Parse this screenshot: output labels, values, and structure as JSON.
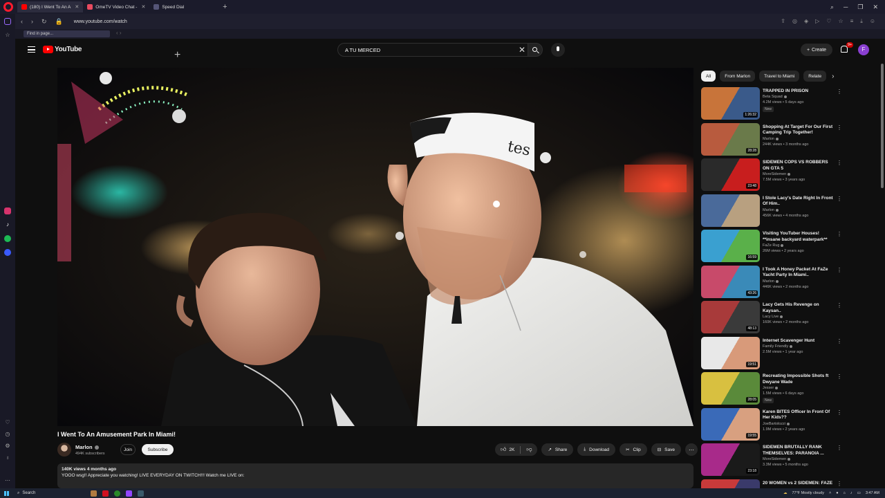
{
  "browser": {
    "tabs": [
      {
        "label": "(180) I Went To An A",
        "active": true,
        "color": "#ff0000"
      },
      {
        "label": "OmeTV Video Chat -",
        "active": false,
        "color": "#e84a5f"
      },
      {
        "label": "Speed Dial",
        "active": false,
        "color": "#8888aa"
      }
    ],
    "new_tab_label": "+",
    "url": "www.youtube.com/watch",
    "find_placeholder": "Find in page..."
  },
  "youtube": {
    "logo_text": "YouTube",
    "search_value": "A TU MERCED",
    "create_label": "Create",
    "notification_count": "9+",
    "avatar_letter": "F"
  },
  "video": {
    "title": "I Went To An Amusement Park In Miami!",
    "channel": "Marlon",
    "subscribers": "494K subscribers",
    "join_label": "Join",
    "subscribe_label": "Subscribe",
    "likes": "2K",
    "share_label": "Share",
    "download_label": "Download",
    "clip_label": "Clip",
    "save_label": "Save",
    "views_date": "140K views  4 months ago",
    "description": "YOOO wsg!! Appreciate you watching! LIVE EVERYDAY ON TWITCH!!! Watch me LIVE on:",
    "cap_text": "tes"
  },
  "chips": [
    {
      "label": "All",
      "active": true
    },
    {
      "label": "From Marlon",
      "active": false
    },
    {
      "label": "Travel to Miami",
      "active": false
    },
    {
      "label": "Relate",
      "active": false
    }
  ],
  "recommendations": [
    {
      "title": "TRAPPED IN PRISON",
      "channel": "Beta Squad",
      "meta": "4.2M views • 5 days ago",
      "badge": "New",
      "duration": "1:26:32",
      "colors": [
        "#c8743a",
        "#3a5a8a"
      ]
    },
    {
      "title": "Shopping At Target For Our First Camping Trip Together!",
      "channel": "Marlon",
      "meta": "244K views • 3 months ago",
      "badge": "",
      "duration": "28:28",
      "colors": [
        "#b85b3e",
        "#6a7a4a"
      ]
    },
    {
      "title": "SIDEMEN COPS VS ROBBERS ON GTA 5",
      "channel": "MoreSidemen",
      "meta": "7.5M views • 3 years ago",
      "badge": "",
      "duration": "23:48",
      "colors": [
        "#2a2a2a",
        "#c81e1e"
      ]
    },
    {
      "title": "I Stole Lacy's Date Right In Front Of Him..",
      "channel": "Marlon",
      "meta": "456K views • 4 months ago",
      "badge": "",
      "duration": "",
      "colors": [
        "#4a6a9a",
        "#b8a080"
      ]
    },
    {
      "title": "Visiting YouTuber Houses! **insane backyard waterpark**",
      "channel": "FaZe Rug",
      "meta": "26M views • 2 years ago",
      "badge": "",
      "duration": "16:59",
      "colors": [
        "#3aa0d0",
        "#5ab04a"
      ]
    },
    {
      "title": "I Took A Honey Packet At FaZe Yacht Party In Miami..",
      "channel": "Marlon",
      "meta": "446K views • 2 months ago",
      "badge": "",
      "duration": "43:26",
      "colors": [
        "#c84a6a",
        "#3a8ab8"
      ]
    },
    {
      "title": "Lacy Gets His Revenge on Kaysan..",
      "channel": "Lacy Live",
      "meta": "160K views • 2 months ago",
      "badge": "",
      "duration": "48:13",
      "colors": [
        "#a83a3a",
        "#3a3a3a"
      ]
    },
    {
      "title": "Internet Scavenger Hunt",
      "channel": "Family Friendly",
      "meta": "2.5M views • 1 year ago",
      "badge": "",
      "duration": "19:51",
      "colors": [
        "#e8e8e8",
        "#d89a7a"
      ]
    },
    {
      "title": "Recreating Impossible Shots ft Dwyane Wade",
      "channel": "Jesser",
      "meta": "1.5M views • 6 days ago",
      "badge": "New",
      "duration": "28:05",
      "colors": [
        "#d8c040",
        "#5a8a3a"
      ]
    },
    {
      "title": "Karen BITES Officer In Front Of Her Kids??",
      "channel": "JoeBartolozzi",
      "meta": "1.9M views • 2 years ago",
      "badge": "",
      "duration": "19:55",
      "colors": [
        "#3a6ab8",
        "#d8a080"
      ]
    },
    {
      "title": "SIDEMEN BRUTALLY RANK THEMSELVES: PARANOIA ...",
      "channel": "MoreSidemen",
      "meta": "3.3M views • 5 months ago",
      "badge": "",
      "duration": "23:18",
      "colors": [
        "#a82a8a",
        "#1a1a1a"
      ]
    },
    {
      "title": "20 WOMEN vs 2 SIDEMEN: FAZE",
      "channel": "",
      "meta": "",
      "badge": "",
      "duration": "",
      "colors": [
        "#c83a3a",
        "#3a3a6a"
      ]
    }
  ],
  "taskbar": {
    "search_label": "Search",
    "weather": "77°F  Mostly cloudy",
    "time": "3:47 AM"
  },
  "colors": {
    "yt_red": "#ff0000",
    "bg": "#0f0f0f",
    "opera_red": "#ff1b2d"
  }
}
